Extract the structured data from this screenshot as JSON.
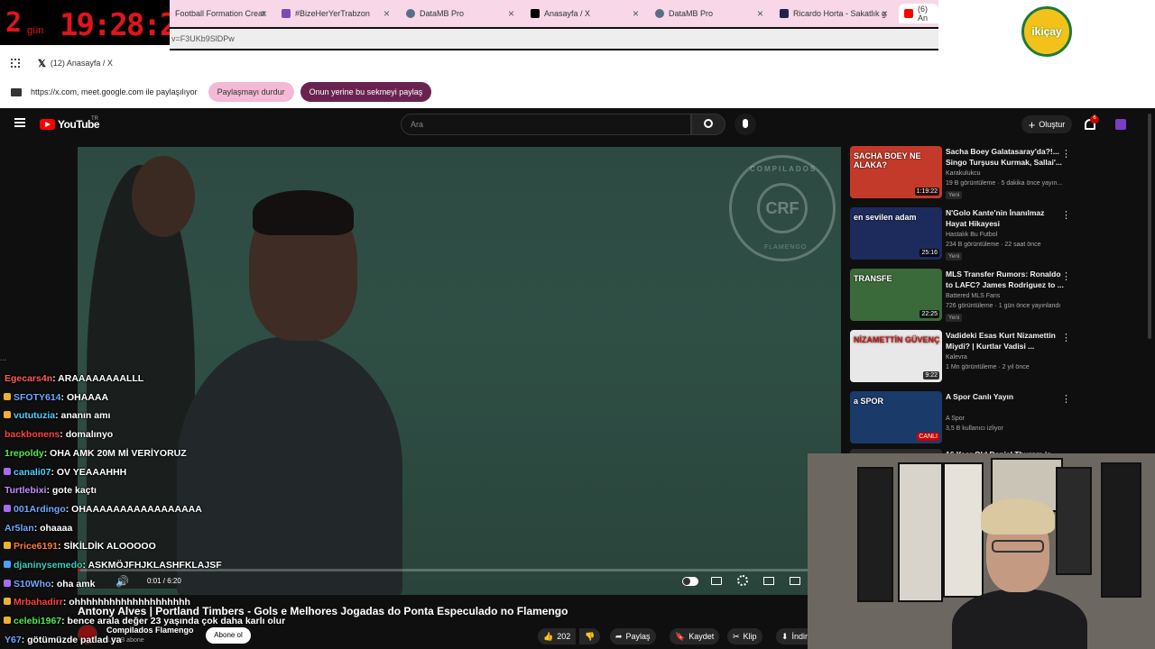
{
  "timer": {
    "days": "2",
    "gun": "gün",
    "clock": "19:28:27"
  },
  "tabs": [
    {
      "label": "Football Formation Creat",
      "color": "#2a7d3a"
    },
    {
      "label": "#BizeHerYerTrabzon",
      "color": "#7c4ab5"
    },
    {
      "label": "DataMB Pro",
      "color": "#5a6c88"
    },
    {
      "label": "Anasayfa / X",
      "color": "#000000"
    },
    {
      "label": "DataMB Pro",
      "color": "#5a6c88"
    },
    {
      "label": "Ricardo Horta - Sakatlık g",
      "color": "#22224a"
    },
    {
      "label": "(6) An",
      "color": "#ff0000"
    }
  ],
  "address": {
    "url": "v=F3UKb9SlDPw"
  },
  "bookmark": {
    "label": "(12) Anasayfa / X"
  },
  "share_bar": {
    "message": "https://x.com, meet.google.com ile paylaşılıyor",
    "stop_label": "Paylaşmayı durdur",
    "share_tab_label": "Onun yerine bu sekmeyi paylaş"
  },
  "logo": {
    "text": "ikiçay"
  },
  "youtube": {
    "brand": "YouTube",
    "region": "TR",
    "search_placeholder": "Ara",
    "create_label": "Oluştur",
    "notif_count": "6"
  },
  "video": {
    "title": "Antony Alves | Portland Timbers - Gols e Melhores Jogadas do Ponta Especulado no Flamengo",
    "time": "0:01 / 6:20",
    "progress": 0.003,
    "crest_top": "COMPILADOS",
    "crest_bottom": "FLAMENGO",
    "channel": "Compilados Flamengo",
    "subs": "1,53 B abone",
    "subscribe": "Abone ol",
    "likes": "202",
    "share": "Paylaş",
    "save": "Kaydet",
    "clip": "Klip",
    "download": "İndir"
  },
  "chat": [
    {
      "user": "Egecars4n",
      "text": ": ARAAAAAAAALLL",
      "color": "#ff5a5a",
      "badge": ""
    },
    {
      "user": "SFOTY614",
      "text": ": OHAAAA",
      "color": "#6fa8ff",
      "badge": "#f0b030"
    },
    {
      "user": "vututuzia",
      "text": ": ananın amı",
      "color": "#4ad0ff",
      "badge": "#f0b030"
    },
    {
      "user": "backbonens",
      "text": ": domalınyo",
      "color": "#ff4040",
      "badge": ""
    },
    {
      "user": "1repoldy",
      "text": ": OHA AMK 20M Mİ VERİYORUZ",
      "color": "#54e854",
      "badge": ""
    },
    {
      "user": "canali07",
      "text": ": OV YEAAAHHH",
      "color": "#4ad0ff",
      "badge": "#a56cff"
    },
    {
      "user": "Turtlebixi",
      "text": ": gote kaçtı",
      "color": "#c58aff",
      "badge": ""
    },
    {
      "user": "001Ardingo",
      "text": ": OHAAAAAAAAAAAAAAAAA",
      "color": "#6fa8ff",
      "badge": "#a56cff"
    },
    {
      "user": "Ar5lan",
      "text": ": ohaaaa",
      "color": "#6fa8ff",
      "badge": ""
    },
    {
      "user": "Price6191",
      "text": ": SİKİLDİK ALOOOOO",
      "color": "#ff7a3a",
      "badge": "#f0b030"
    },
    {
      "user": "djaninysemedo",
      "text": ": ASKMÖJFHJKLASHFKLAJSF",
      "color": "#3ad0c0",
      "badge": "#4aa0ff"
    },
    {
      "user": "S10Who",
      "text": ": oha amk",
      "color": "#6fa8ff",
      "badge": "#a56cff"
    },
    {
      "user": "Mrbahadirr",
      "text": ": ohhhhhhhhhhhhhhhhhhhh",
      "color": "#ff4040",
      "badge": "#f0b030"
    },
    {
      "user": "celebi1967",
      "text": ": bence arala değer 23 yaşında çok daha karlı olur",
      "color": "#54e854",
      "badge": "#f0b030"
    },
    {
      "user": "Y67",
      "text": ": götümüzde patlad ya",
      "color": "#6fa8ff",
      "badge": ""
    }
  ],
  "recommendations": [
    {
      "title": "Sacha Boey Galatasaray'da?!... Singo Turşusu Kurmak, Sallai'...",
      "channel": "Karakulukcu",
      "meta": "19 B görüntüleme · 5 dakika önce yayın...",
      "badge": "Yeni",
      "duration": "1:19:22",
      "thumb_text": "SACHA BOEY NE ALAKA?",
      "bg": "#c43a2a"
    },
    {
      "title": "N'Golo Kante'nin İnanılmaz Hayat Hikayesi",
      "channel": "Hastalık Bu Futbol",
      "meta": "234 B görüntüleme · 22 saat önce",
      "badge": "Yeni",
      "duration": "25:16",
      "thumb_text": "en sevilen adam",
      "bg": "#1d2b5c"
    },
    {
      "title": "MLS Transfer Rumors: Ronaldo to LAFC? James Rodriguez to ...",
      "channel": "Battered MLS Fans",
      "meta": "726 görüntüleme · 1 gün önce yayınlandı",
      "badge": "Yeni",
      "duration": "22:25",
      "thumb_text": "TRANSFE",
      "bg": "#3a6a3a"
    },
    {
      "title": "Vadideki Esas Kurt Nizamettin Miydi? | Kurtlar Vadisi ...",
      "channel": "Kalevra",
      "meta": "1 Mn görüntüleme · 2 yıl önce",
      "badge": "",
      "duration": "9:22",
      "thumb_text": "NİZAMETTİN GÜVENÇ",
      "bg": "#e8e8e8"
    },
    {
      "title": "A Spor Canlı Yayın",
      "channel": "A Spor",
      "meta": "3,5 B kullanıcı izliyor",
      "badge": "",
      "duration": "CANLI",
      "thumb_text": "a SPOR",
      "bg": "#1a3a6a"
    },
    {
      "title": "16 Year Old Daniel Thuram is",
      "channel": "",
      "meta": "",
      "badge": "",
      "duration": "",
      "thumb_text": "",
      "bg": "#2a2a2a"
    }
  ]
}
